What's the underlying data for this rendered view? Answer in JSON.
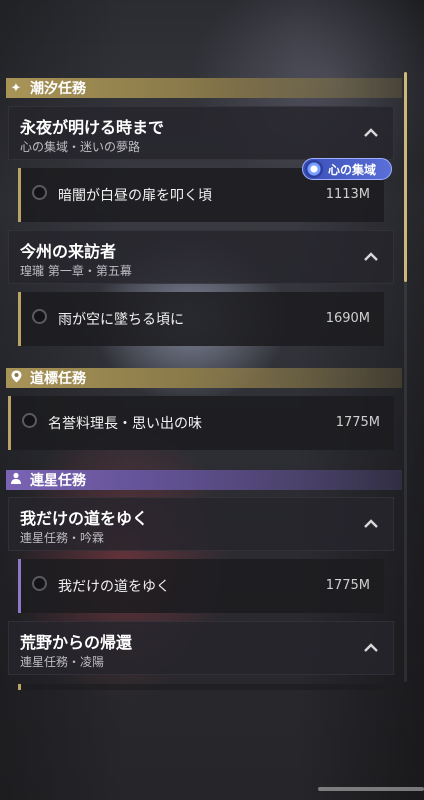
{
  "sections": {
    "tide": {
      "title": "潮汐任務",
      "icon": "sparkle-icon",
      "color": "#a99457"
    },
    "guide": {
      "title": "道標任務",
      "icon": "location-pin-icon",
      "color": "#a99457"
    },
    "companion": {
      "title": "連星任務",
      "icon": "person-icon",
      "color": "#7a63b5"
    }
  },
  "quests": [
    {
      "title": "永夜が明ける時まで",
      "subtitle": "心の集域・迷いの夢路",
      "expanded": true
    },
    {
      "title": "今州の来訪者",
      "subtitle": "瑝瓏 第一章・第五幕",
      "expanded": true
    },
    {
      "title": "我だけの道をゆく",
      "subtitle": "連星任務・吟霖",
      "expanded": true
    },
    {
      "title": "荒野からの帰還",
      "subtitle": "連星任務・凌陽",
      "expanded": true
    }
  ],
  "tasks": [
    {
      "label": "暗闇が白昼の扉を叩く頃",
      "distance": "1113M"
    },
    {
      "label": "雨が空に墜ちる頃に",
      "distance": "1690M"
    },
    {
      "label": "名誉料理長・思い出の味",
      "distance": "1775M"
    },
    {
      "label": "我だけの道をゆく",
      "distance": "1775M"
    }
  ],
  "badge": {
    "label": "心の集域",
    "icon": "swirl-icon",
    "color": "#4a5fc8"
  },
  "colors": {
    "gold_accent": "#b9a466",
    "purple_accent": "#8c79c9"
  }
}
